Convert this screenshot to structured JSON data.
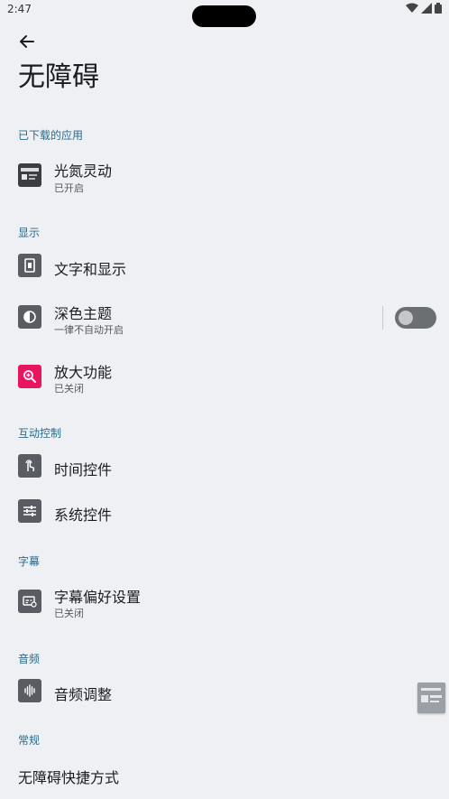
{
  "status_bar": {
    "time": "2:47"
  },
  "page": {
    "title": "无障碍"
  },
  "sections": {
    "downloaded": "已下载的应用",
    "display": "显示",
    "interaction": "互动控制",
    "captions": "字幕",
    "audio": "音频",
    "general": "常规"
  },
  "items": {
    "app_guangdan": {
      "label": "光氮灵动",
      "sub": "已开启",
      "icon": "app-thumbnail-icon"
    },
    "text_display": {
      "label": "文字和显示",
      "icon": "text-display-icon"
    },
    "dark_theme": {
      "label": "深色主题",
      "sub": "一律不自动开启",
      "icon": "contrast-icon",
      "toggle_on": false
    },
    "magnify": {
      "label": "放大功能",
      "sub": "已关闭",
      "icon": "zoom-in-icon",
      "accent": "#e8145d"
    },
    "timing": {
      "label": "时间控件",
      "icon": "touch-hand-icon"
    },
    "system_controls": {
      "label": "系统控件",
      "icon": "sliders-icon"
    },
    "caption_prefs": {
      "label": "字幕偏好设置",
      "sub": "已关闭",
      "icon": "caption-icon"
    },
    "audio_adjust": {
      "label": "音频调整",
      "icon": "audio-wave-icon"
    },
    "shortcuts": {
      "label": "无障碍快捷方式"
    }
  }
}
